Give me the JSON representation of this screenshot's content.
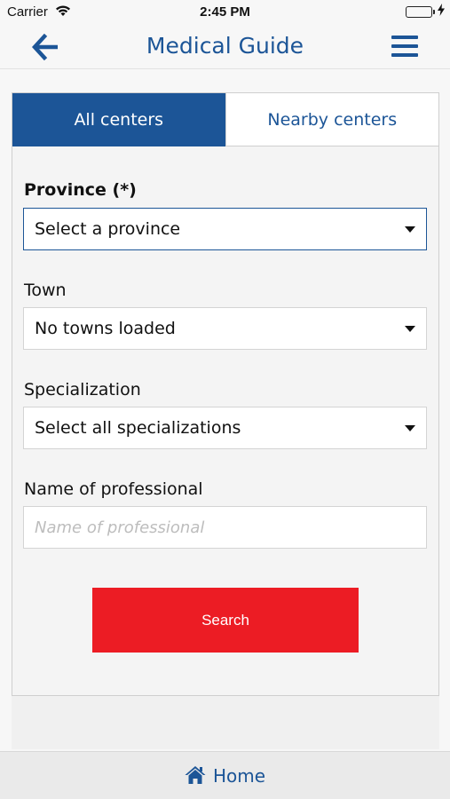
{
  "status_bar": {
    "carrier": "Carrier",
    "time": "2:45 PM",
    "battery_level": 1.0,
    "icons": [
      "wifi-icon",
      "battery-icon",
      "charging-icon"
    ]
  },
  "nav": {
    "title": "Medical Guide",
    "back_icon": "back-arrow-icon",
    "menu_icon": "hamburger-menu-icon"
  },
  "tabs": [
    {
      "label": "All centers",
      "active": true
    },
    {
      "label": "Nearby centers",
      "active": false
    }
  ],
  "form": {
    "province": {
      "label": "Province (*)",
      "value": "Select a province"
    },
    "town": {
      "label": "Town",
      "value": "No towns loaded"
    },
    "specialization": {
      "label": "Specialization",
      "value": "Select all specializations"
    },
    "professional": {
      "label": "Name of professional",
      "placeholder": "Name of professional",
      "value": ""
    },
    "search_label": "Search"
  },
  "bottom": {
    "home_label": "Home",
    "home_icon": "home-icon"
  },
  "colors": {
    "brand": "#1c5597",
    "search": "#ec1c24",
    "battery": "#4cd964"
  }
}
